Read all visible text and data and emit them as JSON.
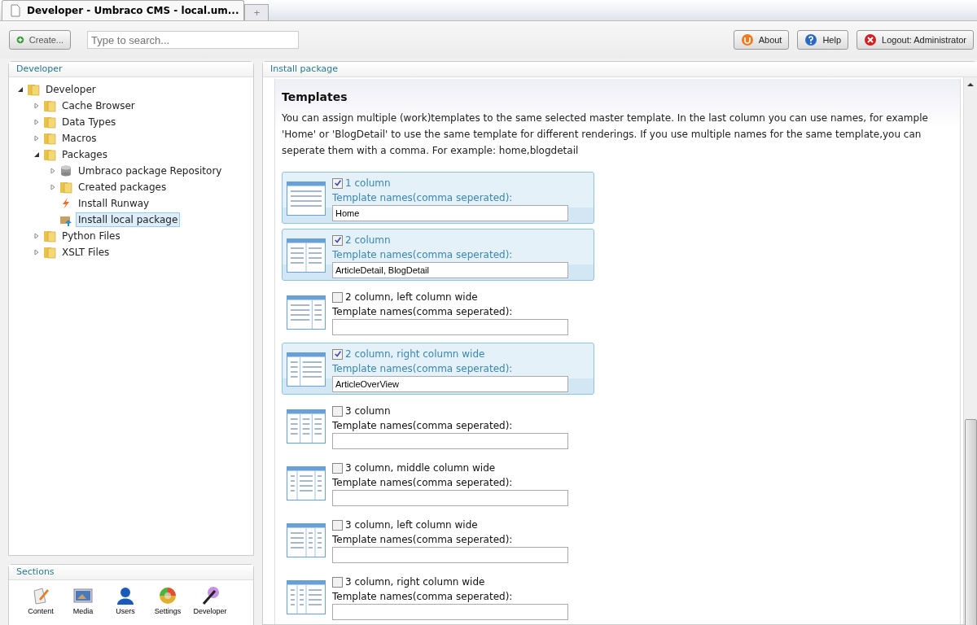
{
  "browser_tab": {
    "title": "Developer - Umbraco CMS - local.um...",
    "new_tab": "+"
  },
  "toolbar": {
    "create": "Create...",
    "search": {
      "placeholder": "Type to search..."
    },
    "buttons": [
      {
        "kind": "about",
        "label": "About"
      },
      {
        "kind": "help",
        "label": "Help"
      },
      {
        "kind": "logout",
        "label": "Logout: Administrator"
      }
    ]
  },
  "tree_panel": {
    "title": "Developer",
    "tree": [
      {
        "label": "Developer",
        "kind": "folder",
        "selected": false,
        "expanded": true,
        "children": [
          {
            "label": "Cache Browser",
            "kind": "folder",
            "selected": false,
            "expanded": false
          },
          {
            "label": "Data Types",
            "kind": "folder",
            "selected": false,
            "expanded": false
          },
          {
            "label": "Macros",
            "kind": "folder",
            "selected": false,
            "expanded": false
          },
          {
            "label": "Packages",
            "kind": "folder",
            "selected": false,
            "expanded": true,
            "children": [
              {
                "label": "Umbraco package Repository",
                "kind": "database",
                "selected": false,
                "expanded": false
              },
              {
                "label": "Created packages",
                "kind": "folder",
                "selected": false,
                "expanded": false
              },
              {
                "label": "Install Runway",
                "kind": "bolt",
                "selected": false
              },
              {
                "label": "Install local package",
                "kind": "box",
                "selected": true
              }
            ]
          },
          {
            "label": "Python Files",
            "kind": "folder",
            "selected": false,
            "expanded": false
          },
          {
            "label": "XSLT Files",
            "kind": "folder",
            "selected": false,
            "expanded": false
          }
        ]
      }
    ]
  },
  "sections_panel": {
    "title": "Sections",
    "items": [
      {
        "kind": "content",
        "label": "Content"
      },
      {
        "kind": "media",
        "label": "Media"
      },
      {
        "kind": "users",
        "label": "Users"
      },
      {
        "kind": "settings",
        "label": "Settings"
      },
      {
        "kind": "developer",
        "label": "Developer"
      }
    ]
  },
  "main_panel": {
    "title": "Install package",
    "heading": "Templates",
    "description": "You can assign multiple (work)templates to the same selected master template. In the last column you can use names, for example 'Home' or 'BlogDetail' to use the same template for different renderings. If you use multiple names for the same template,you can seperate them with a comma. For example: home,blogdetail",
    "templates": [
      {
        "kind": "onecolumn",
        "name": "1 column",
        "checked": true,
        "field_label": "Template names(comma seperated):",
        "value": "Home"
      },
      {
        "kind": "twocolumn",
        "name": "2 column",
        "checked": true,
        "field_label": "Template names(comma seperated):",
        "value": "ArticleDetail, BlogDetail"
      },
      {
        "kind": "twoleftwide",
        "name": "2 column, left column wide",
        "checked": false,
        "field_label": "Template names(comma seperated):"
      },
      {
        "kind": "tworightwide",
        "name": "2 column, right column wide",
        "checked": true,
        "field_label": "Template names(comma seperated):",
        "value": "ArticleOverView"
      },
      {
        "kind": "threecolumn",
        "name": "3 column",
        "checked": false,
        "field_label": "Template names(comma seperated):"
      },
      {
        "kind": "threemiddlewide",
        "name": "3 column, middle column wide",
        "checked": false,
        "field_label": "Template names(comma seperated):"
      },
      {
        "kind": "threeleftwide",
        "name": "3 column, left column wide",
        "checked": false,
        "field_label": "Template names(comma seperated):"
      },
      {
        "kind": "threerightwide",
        "name": "3 column, right column wide",
        "checked": false,
        "field_label": "Template names(comma seperated):"
      }
    ]
  }
}
